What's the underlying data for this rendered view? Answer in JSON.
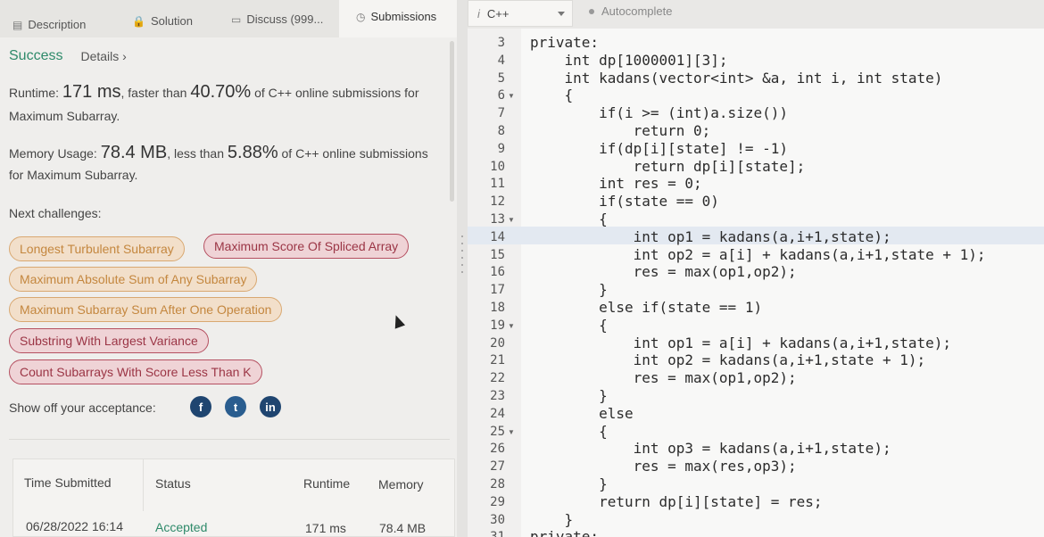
{
  "tabs": {
    "description": "Description",
    "solution": "Solution",
    "discuss": "Discuss (999...",
    "submissions": "Submissions"
  },
  "result": {
    "status": "Success",
    "details": "Details",
    "runtime_label": "Runtime:",
    "runtime_value": "171 ms",
    "runtime_mid": ", faster than",
    "runtime_pct": "40.70%",
    "runtime_tail": "of C++ online submissions for",
    "runtime_tail2": "Maximum Subarray.",
    "memory_label": "Memory Usage:",
    "memory_value": "78.4 MB",
    "memory_mid": ", less than",
    "memory_pct": "5.88%",
    "memory_tail": "of C++ online submissions",
    "memory_tail2": "for Maximum Subarray."
  },
  "next_challenges": {
    "label": "Next challenges:",
    "items": [
      {
        "label": "Longest Turbulent Subarray",
        "difficulty": "medium"
      },
      {
        "label": "Maximum Score Of Spliced Array",
        "difficulty": "hard"
      },
      {
        "label": "Maximum Absolute Sum of Any Subarray",
        "difficulty": "medium"
      },
      {
        "label": "Maximum Subarray Sum After One Operation",
        "difficulty": "medium"
      },
      {
        "label": "Substring With Largest Variance",
        "difficulty": "hard"
      },
      {
        "label": "Count Subarrays With Score Less Than K",
        "difficulty": "hard"
      }
    ]
  },
  "share": {
    "label": "Show off your acceptance:",
    "icons": [
      "facebook-icon",
      "twitter-icon",
      "linkedin-icon"
    ]
  },
  "submissions_table": {
    "headers": [
      "Time Submitted",
      "Status",
      "Runtime",
      "Memory"
    ],
    "rows": [
      {
        "time": "06/28/2022 16:14",
        "status": "Accepted",
        "runtime": "171 ms",
        "memory": "78.4 MB"
      }
    ]
  },
  "editor": {
    "language": "C++",
    "autocomplete": "Autocomplete",
    "lines": [
      {
        "n": "3",
        "code": "private:"
      },
      {
        "n": "4",
        "code": "    int dp[1000001][3];"
      },
      {
        "n": "5",
        "code": "    int kadans(vector<int> &a, int i, int state)"
      },
      {
        "n": "6",
        "code": "    {"
      },
      {
        "n": "7",
        "code": "        if(i >= (int)a.size())"
      },
      {
        "n": "8",
        "code": "            return 0;"
      },
      {
        "n": "9",
        "code": "        if(dp[i][state] != -1)"
      },
      {
        "n": "10",
        "code": "            return dp[i][state];"
      },
      {
        "n": "11",
        "code": "        int res = 0;"
      },
      {
        "n": "12",
        "code": "        if(state == 0)"
      },
      {
        "n": "13",
        "code": "        {"
      },
      {
        "n": "14",
        "code": "            int op1 = kadans(a,i+1,state);"
      },
      {
        "n": "15",
        "code": "            int op2 = a[i] + kadans(a,i+1,state + 1);"
      },
      {
        "n": "16",
        "code": "            res = max(op1,op2);"
      },
      {
        "n": "17",
        "code": "        }"
      },
      {
        "n": "18",
        "code": "        else if(state == 1)"
      },
      {
        "n": "19",
        "code": "        {"
      },
      {
        "n": "20",
        "code": "            int op1 = a[i] + kadans(a,i+1,state);"
      },
      {
        "n": "21",
        "code": "            int op2 = kadans(a,i+1,state + 1);"
      },
      {
        "n": "22",
        "code": "            res = max(op1,op2);"
      },
      {
        "n": "23",
        "code": "        }"
      },
      {
        "n": "24",
        "code": "        else"
      },
      {
        "n": "25",
        "code": "        {"
      },
      {
        "n": "26",
        "code": "            int op3 = kadans(a,i+1,state);"
      },
      {
        "n": "27",
        "code": "            res = max(res,op3);"
      },
      {
        "n": "28",
        "code": "        }"
      },
      {
        "n": "29",
        "code": "        return dp[i][state] = res;"
      },
      {
        "n": "30",
        "code": "    }"
      },
      {
        "n": "31",
        "code": "private:"
      }
    ]
  }
}
